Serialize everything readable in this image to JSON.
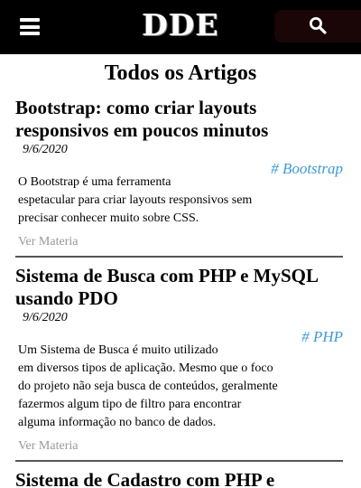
{
  "header": {
    "logo": "DDE",
    "menu_icon": "hamburger-menu-icon",
    "search_icon": "search-icon",
    "search_bg": "#1a0507"
  },
  "page_title": "Todos os Artigos",
  "articles": [
    {
      "title_lines": [
        "Bootstrap: como criar layouts",
        "responsivos em poucos minutos"
      ],
      "date": "9/6/2020",
      "tag": "# Bootstrap",
      "excerpt_lines": [
        "O Bootstrap é uma ferramenta",
        "espetacular para criar layouts responsivos sem",
        "precisar conhecer muito sobre CSS."
      ],
      "link": "Ver Materia"
    },
    {
      "title_lines": [
        "Sistema de Busca com PHP e MySQL",
        "usando PDO"
      ],
      "date": "9/6/2020",
      "tag": "# PHP",
      "excerpt_lines": [
        "Um Sistema de Busca é muito utilizado",
        "em diversos tipos de aplicação. Mesmo que o foco",
        "do projeto não seja busca de conteúdos, geralmente",
        "fazermos algum tipo de filtro para encontrar",
        "alguma informação no banco de dados."
      ],
      "link": "Ver Materia"
    },
    {
      "title_lines": [
        "Sistema de Cadastro com PHP e"
      ]
    }
  ],
  "colors": {
    "tag": "#3d9ad8",
    "link": "#999999",
    "header_bg": "#000000"
  }
}
